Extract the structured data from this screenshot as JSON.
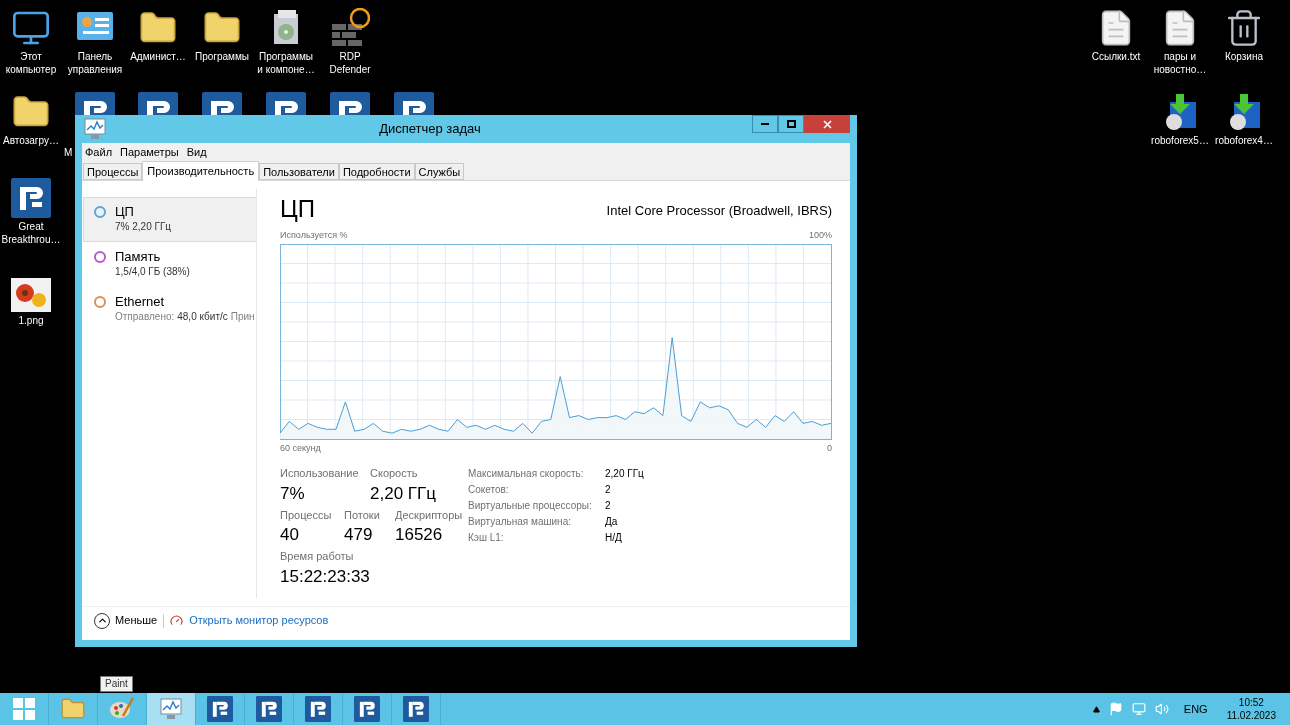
{
  "desktop": {
    "icons": [
      {
        "kind": "computer",
        "label": "Этот компьютер"
      },
      {
        "kind": "control-panel",
        "label": "Панель управления"
      },
      {
        "kind": "folder",
        "label": "Админист…"
      },
      {
        "kind": "folder",
        "label": "Программы"
      },
      {
        "kind": "programs",
        "label": "Программы и компоне…"
      },
      {
        "kind": "firewall",
        "label": "RDP Defender"
      },
      {
        "kind": "folder",
        "label": "Автозагру…"
      },
      {
        "kind": "r-logo",
        "label": "М"
      },
      {
        "kind": "r-logo"
      },
      {
        "kind": "r-logo"
      },
      {
        "kind": "r-logo"
      },
      {
        "kind": "r-logo"
      },
      {
        "kind": "r-logo"
      },
      {
        "kind": "r-logo",
        "label": "Great Breakthrou…"
      },
      {
        "kind": "image",
        "label": "1.png"
      },
      {
        "kind": "file",
        "label": "Ссылки.txt"
      },
      {
        "kind": "file",
        "label": "пары и новостно…"
      },
      {
        "kind": "trash",
        "label": "Корзина"
      },
      {
        "kind": "installer",
        "label": "roboforex5…"
      },
      {
        "kind": "installer",
        "label": "roboforex4…"
      }
    ]
  },
  "window": {
    "title": "Диспетчер задач",
    "menu": [
      "Файл",
      "Параметры",
      "Вид"
    ],
    "tabs": [
      {
        "label": "Процессы",
        "selected": false
      },
      {
        "label": "Производительность",
        "selected": true
      },
      {
        "label": "Пользователи",
        "selected": false
      },
      {
        "label": "Подробности",
        "selected": false
      },
      {
        "label": "Службы",
        "selected": false
      }
    ],
    "sidebar": {
      "items": [
        {
          "name": "ЦП",
          "color": "#5aa7dc",
          "selected": true,
          "detail": [
            {
              "kind": "value",
              "text": "7%  2,20 ГГц"
            }
          ]
        },
        {
          "name": "Память",
          "color": "#b45ccc",
          "selected": false,
          "detail": [
            {
              "kind": "value",
              "text": "1,5/4,0 ГБ (38%)"
            }
          ]
        },
        {
          "name": "Ethernet",
          "color": "#d4915a",
          "selected": false,
          "detail": [
            {
              "kind": "label",
              "text": "Отправлено:"
            },
            {
              "kind": "value",
              "text": "48,0 кбит/с"
            },
            {
              "kind": "label",
              "text": "Прин"
            }
          ]
        }
      ]
    },
    "main": {
      "title": "ЦП",
      "processor": "Intel Core Processor (Broadwell, IBRS)",
      "graph": {
        "caption": "Используется %",
        "max_label": "100%",
        "start_label": "60 секунд",
        "end_label": "0"
      },
      "stats_top": [
        {
          "label": "Использование",
          "value": "7%"
        },
        {
          "label": "Скорость",
          "value": "2,20 ГГц"
        }
      ],
      "stats_mid": [
        {
          "label": "Процессы",
          "value": "40"
        },
        {
          "label": "Потоки",
          "value": "479"
        },
        {
          "label": "Дескрипторы",
          "value": "16526"
        }
      ],
      "uptime": {
        "label": "Время работы",
        "value": "15:22:23:33"
      },
      "details": [
        {
          "label": "Максимальная скорость:",
          "value": "2,20 ГГц"
        },
        {
          "label": "Сокетов:",
          "value": "2"
        },
        {
          "label": "Виртуальные процессоры:",
          "value": "2"
        },
        {
          "label": "Виртуальная машина:",
          "value": "Да"
        },
        {
          "label": "Кэш L1:",
          "value": "Н/Д"
        }
      ]
    },
    "footer": {
      "less": "Меньше",
      "link": "Открыть монитор ресурсов"
    }
  },
  "tooltip": "Paint",
  "taskbar": {
    "buttons": [
      {
        "kind": "start",
        "selected": false
      },
      {
        "kind": "explorer",
        "selected": false
      },
      {
        "kind": "paint",
        "selected": false
      },
      {
        "kind": "task-manager",
        "selected": true
      },
      {
        "kind": "r-logo",
        "selected": false
      },
      {
        "kind": "r-logo",
        "selected": false
      },
      {
        "kind": "r-logo",
        "selected": false
      },
      {
        "kind": "r-logo",
        "selected": false
      },
      {
        "kind": "r-logo",
        "selected": false
      }
    ],
    "language": "ENG",
    "time": "10:52",
    "date": "11.02.2023"
  }
}
